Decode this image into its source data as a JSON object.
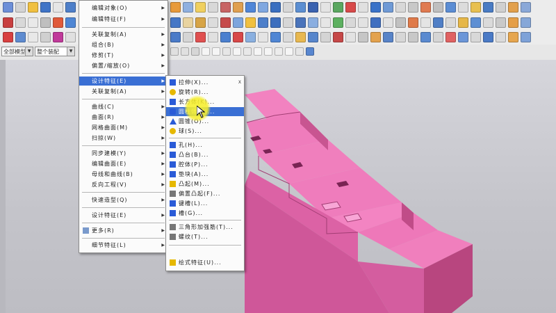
{
  "toolbar": {
    "combo_filter_value": "全部模型",
    "combo_scope_value": "整个装配",
    "combo_arrow": "▼"
  },
  "main_menu": {
    "items": [
      {
        "label": "编辑对象(O)",
        "submenu": true
      },
      {
        "label": "编辑特征(F)",
        "submenu": true
      },
      {
        "label": "关联复制(A)",
        "submenu": true
      },
      {
        "label": "组合(B)",
        "submenu": true
      },
      {
        "label": "修剪(T)",
        "submenu": true
      },
      {
        "label": "偏置/缩放(O)",
        "submenu": true
      },
      {
        "label": "细节特征(L)",
        "submenu": true
      },
      {
        "label": "设计特征(E)",
        "submenu": true,
        "selected": true
      },
      {
        "label": "关联复制(A)",
        "submenu": true
      },
      {
        "label": "曲线(C)",
        "submenu": true
      },
      {
        "label": "曲面(R)",
        "submenu": true
      },
      {
        "label": "网格曲面(M)",
        "submenu": true
      },
      {
        "label": "扫掠(W)",
        "submenu": true
      },
      {
        "label": "同步建模(Y)",
        "submenu": true
      },
      {
        "label": "编辑曲面(E)",
        "submenu": true
      },
      {
        "label": "母线和曲线(B)",
        "submenu": true
      },
      {
        "label": "反向工程(V)",
        "submenu": true
      },
      {
        "label": "快速造型(Q)",
        "submenu": true
      },
      {
        "label": "设计特征(E)",
        "submenu": true
      },
      {
        "label": "更多(R)",
        "submenu": true
      }
    ]
  },
  "sub_menu": {
    "items": [
      {
        "label": "拉伸(X)...",
        "icon": "extrude-icon",
        "color": "#2a5bd7",
        "shortcut": "X"
      },
      {
        "label": "旋转(R)...",
        "icon": "revolve-icon",
        "color": "#e6b800"
      },
      {
        "label": "长方体(K)...",
        "icon": "block-icon",
        "color": "#2a5bd7"
      },
      {
        "label": "圆柱体(C)...",
        "icon": "cylinder-icon",
        "color": "#2a5bd7",
        "selected": true
      },
      {
        "label": "圆锥(O)...",
        "icon": "cone-icon",
        "color": "#2a5bd7"
      },
      {
        "label": "球(S)...",
        "icon": "sphere-icon",
        "color": "#e6b800"
      },
      {
        "label": "孔(H)...",
        "icon": "hole-icon",
        "color": "#2a5bd7"
      },
      {
        "label": "凸台(B)...",
        "icon": "boss-icon",
        "color": "#2a5bd7"
      },
      {
        "label": "腔体(P)...",
        "icon": "pocket-icon",
        "color": "#2a5bd7"
      },
      {
        "label": "垫块(A)...",
        "icon": "pad-icon",
        "color": "#2a5bd7"
      },
      {
        "label": "凸起(M)...",
        "icon": "emboss-icon",
        "color": "#e6b800"
      },
      {
        "label": "偏置凸起(F)...",
        "icon": "offset-emboss-icon",
        "color": "#777777"
      },
      {
        "label": "键槽(L)...",
        "icon": "slot-icon",
        "color": "#2a5bd7"
      },
      {
        "label": "槽(G)...",
        "icon": "groove-icon",
        "color": "#2a5bd7"
      },
      {
        "label": "三角形加强筋(T)...",
        "icon": "rib-icon",
        "color": "#777777"
      },
      {
        "label": "螺纹(T)...",
        "icon": "thread-icon",
        "color": "#777777"
      },
      {
        "label": "绘式特征(U)...",
        "icon": "draw-feature-icon",
        "color": "#e6b800"
      }
    ]
  },
  "colors": {
    "menu_highlight": "#3a6fd4",
    "part_face_top": "#f07fbd",
    "part_face_side": "#dc62a5",
    "part_face_dark": "#b8467f",
    "cursor_halo": "#f6ee28"
  }
}
